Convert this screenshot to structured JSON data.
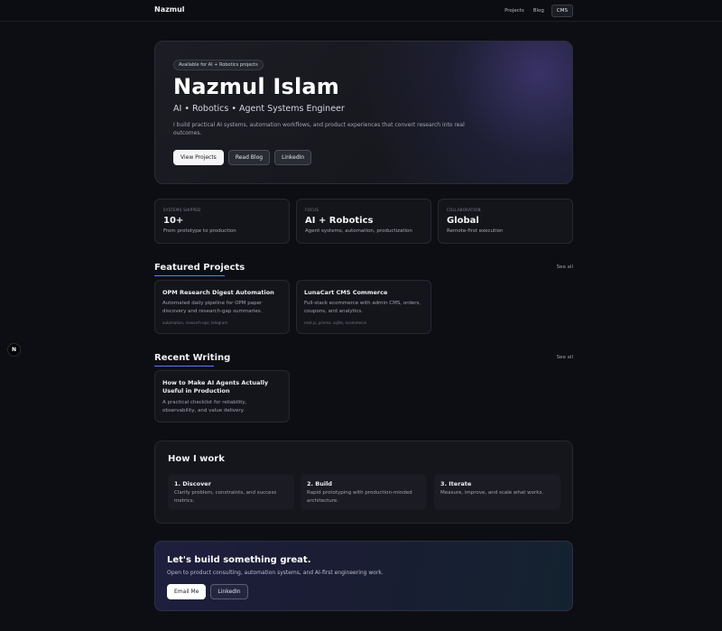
{
  "header": {
    "brand": "Nazmul",
    "nav": [
      {
        "label": "Projects"
      },
      {
        "label": "Blog"
      },
      {
        "label": "CMS"
      }
    ]
  },
  "hero": {
    "badge": "Available for AI + Robotics projects",
    "name": "Nazmul Islam",
    "role": "AI • Robotics • Agent Systems Engineer",
    "description": "I build practical AI systems, automation workflows, and product experiences that convert research into real outcomes.",
    "buttons": {
      "view_projects": "View Projects",
      "read_blog": "Read Blog",
      "linkedin": "LinkedIn"
    }
  },
  "stats": [
    {
      "key": "SYSTEMS SHIPPED",
      "value": "10+",
      "desc": "From prototype to production"
    },
    {
      "key": "FOCUS",
      "value": "AI + Robotics",
      "desc": "Agent systems, automation, productization"
    },
    {
      "key": "COLLABORATION",
      "value": "Global",
      "desc": "Remote-first execution"
    }
  ],
  "featured": {
    "title": "Featured Projects",
    "see_all": "See all",
    "projects": [
      {
        "title": "OPM Research Digest Automation",
        "summary": "Automated daily pipeline for OPM paper discovery and research-gap summaries.",
        "tags": "automation, research-ops, telegram"
      },
      {
        "title": "LunaCart CMS Commerce",
        "summary": "Full-stack ecommerce with admin CMS, orders, coupons, and analytics.",
        "tags": "next.js, prisma, sqlite, ecommerce"
      }
    ]
  },
  "writing": {
    "title": "Recent Writing",
    "see_all": "See all",
    "posts": [
      {
        "title": "How to Make AI Agents Actually Useful in Production",
        "summary": "A practical checklist for reliability, observability, and value delivery."
      }
    ]
  },
  "how": {
    "title": "How I work",
    "steps": [
      {
        "title": "1. Discover",
        "desc": "Clarify problem, constraints, and success metrics."
      },
      {
        "title": "2. Build",
        "desc": "Rapid prototyping with production-minded architecture."
      },
      {
        "title": "3. Iterate",
        "desc": "Measure, improve, and scale what works."
      }
    ]
  },
  "cta": {
    "title": "Let's build something great.",
    "text": "Open to product consulting, automation systems, and AI-first engineering work.",
    "email_label": "Email Me",
    "linkedin_label": "LinkedIn"
  },
  "floating": {
    "label": "N"
  }
}
